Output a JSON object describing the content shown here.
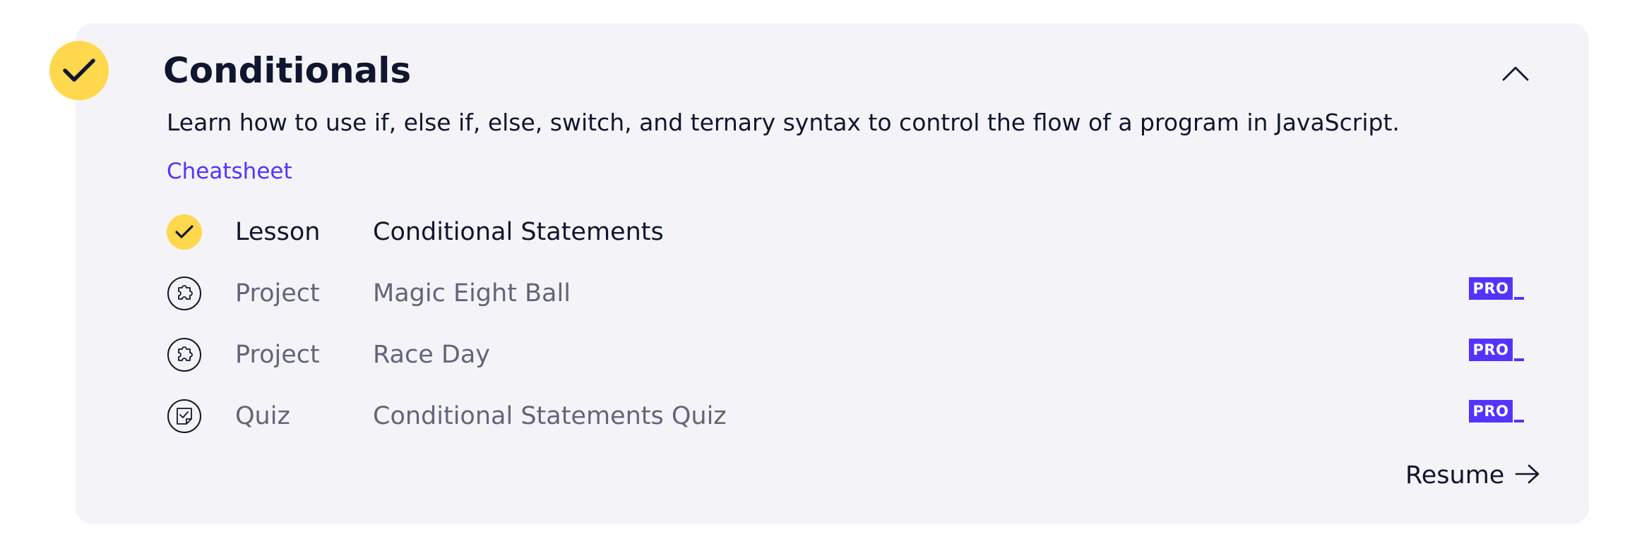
{
  "module": {
    "title": "Conditionals",
    "status_icon": "check-icon",
    "toggle_icon": "chevron-up-icon",
    "description": "Learn how to use if, else if, else, switch, and ternary syntax to control the flow of a program in JavaScript.",
    "cheatsheet_label": "Cheatsheet",
    "items": [
      {
        "type": "Lesson",
        "name": "Conditional Statements",
        "icon": "check-icon",
        "completed": true,
        "pro_label": ""
      },
      {
        "type": "Project",
        "name": "Magic Eight Ball",
        "icon": "puzzle-icon",
        "completed": false,
        "pro_label": "PRO"
      },
      {
        "type": "Project",
        "name": "Race Day",
        "icon": "puzzle-icon",
        "completed": false,
        "pro_label": "PRO"
      },
      {
        "type": "Quiz",
        "name": "Conditional Statements Quiz",
        "icon": "quiz-icon",
        "completed": false,
        "pro_label": "PRO"
      }
    ],
    "resume_label": "Resume",
    "resume_icon": "arrow-right-icon"
  },
  "colors": {
    "card_background": "#f4f4f8",
    "complete_yellow": "#ffd84d",
    "accent_purple": "#5533ff",
    "text_dark": "#10162f",
    "text_muted": "#62657a"
  }
}
